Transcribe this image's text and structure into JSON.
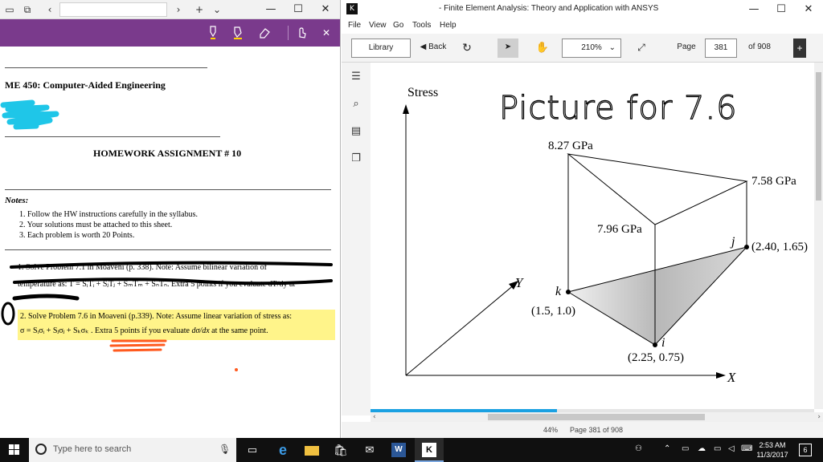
{
  "browser": {
    "tab_title": "",
    "toolbar_icons": [
      "pen-icon",
      "highlighter-icon",
      "eraser-icon",
      "touch-writing-icon",
      "close-icon"
    ],
    "document": {
      "course_title": "ME 450: Computer-Aided Engineering",
      "hw_title": "HOMEWORK ASSIGNMENT # 10",
      "notes_title": "Notes:",
      "notes": [
        "1.   Follow the HW instructions carefully in the syllabus.",
        "2.   Your solutions must be attached to this sheet.",
        "3.   Each problem is worth 20 Points."
      ],
      "problem1_line1": "1.  Solve Problem 7.1 in Moaveni (p. 338).   Note:  Assume bilinear variation of",
      "problem1_line2": "temperature as: T = SᵢTᵢ + SⱼTⱼ + SₘTₘ + SₙTₙ. Extra 5 points if you evaluate dT/dy at",
      "problem2_line1": "2.  Solve Problem 7.6 in Moaveni (p.339).   Note: Assume linear variation of stress as:",
      "problem2_line2_a": "σ = Sᵢσᵢ + Sⱼσⱼ + Sₖσₖ .  ",
      "problem2_line2_b": "Extra 5 points if you evaluate",
      "problem2_line2_c": "dσ/dx",
      "problem2_line2_d": " at the same point."
    }
  },
  "viewer": {
    "title": "- Finite Element Analysis: Theory and Application with ANSYS",
    "menu": [
      "File",
      "View",
      "Go",
      "Tools",
      "Help"
    ],
    "toolbar": {
      "library": "Library",
      "back": "Back",
      "zoom": "210%",
      "page_label": "Page",
      "page_value": "381",
      "of_pages": "of 908"
    },
    "status_zoom": "44%",
    "status_page": "Page 381 of 908",
    "reading_progress": 0.42
  },
  "diagram": {
    "handwritten_note": "Picture for 7.6",
    "axis_stress": "Stress",
    "axis_x": "X",
    "axis_y": "Y",
    "nodes": [
      {
        "label": "i",
        "coord": "(2.25, 0.75)",
        "stress": "7.96 GPa"
      },
      {
        "label": "j",
        "coord": "(2.40, 1.65)",
        "stress": "7.58 GPa"
      },
      {
        "label": "k",
        "coord": "(1.5, 1.0)",
        "stress": "8.27 GPa"
      }
    ]
  },
  "taskbar": {
    "search_placeholder": "Type here to search",
    "apps": [
      "task-view-icon",
      "edge-icon",
      "file-explorer-icon",
      "store-icon",
      "mail-icon",
      "word-icon",
      "pdf-viewer-icon"
    ],
    "clock_time": "2:53 AM",
    "clock_date": "11/3/2017",
    "notification_count": "6"
  },
  "colors": {
    "browser_toolbar": "#7a3a8c",
    "highlight": "#fff48a",
    "cyan_scribble": "#1fc6e8",
    "orange_scribble": "#ff5a1f",
    "progress": "#1ba1e2"
  }
}
